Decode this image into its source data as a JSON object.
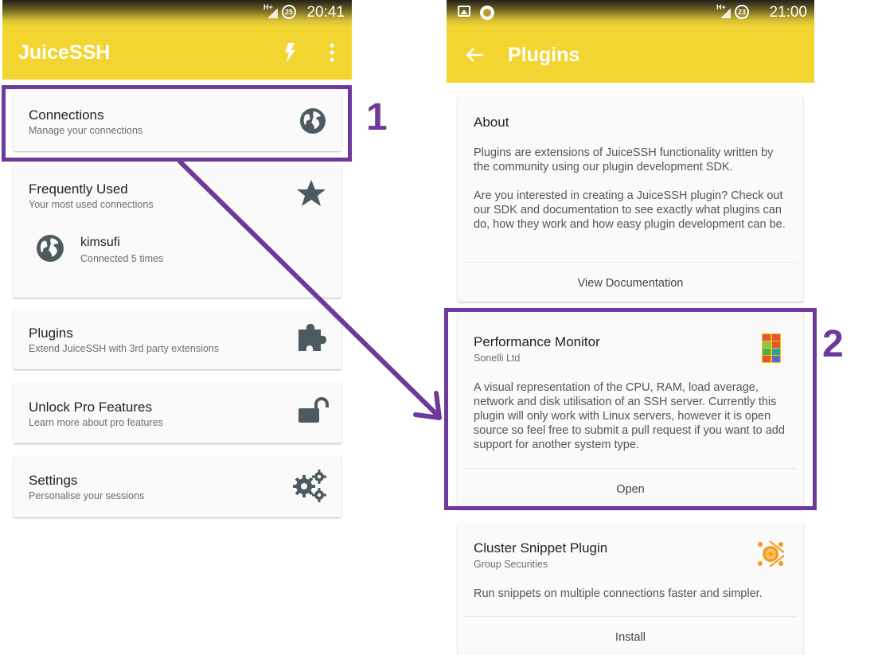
{
  "left": {
    "status": {
      "network": "H+",
      "battery": "25",
      "time": "20:41"
    },
    "appbar": {
      "title": "JuiceSSH"
    },
    "cards": {
      "connections": {
        "title": "Connections",
        "subtitle": "Manage your connections"
      },
      "frequent": {
        "title": "Frequently Used",
        "subtitle": "Your most used connections",
        "item": {
          "name": "kimsufi",
          "detail": "Connected 5 times"
        }
      },
      "plugins": {
        "title": "Plugins",
        "subtitle": "Extend JuiceSSH with 3rd party extensions"
      },
      "unlock": {
        "title": "Unlock Pro Features",
        "subtitle": "Learn more about pro features"
      },
      "settings": {
        "title": "Settings",
        "subtitle": "Personalise your sessions"
      }
    }
  },
  "right": {
    "status": {
      "network": "H+",
      "battery": "23",
      "time": "21:00"
    },
    "appbar": {
      "title": "Plugins"
    },
    "about": {
      "title": "About",
      "para1": "Plugins are extensions of JuiceSSH functionality written by the community using our plugin development SDK.",
      "para2": "Are you interested in creating a JuiceSSH plugin? Check out our SDK and documentation to see exactly what plugins can do, how they work and how easy plugin development can be.",
      "action": "View Documentation"
    },
    "perf": {
      "title": "Performance Monitor",
      "author": "Sonelli Ltd",
      "description": "A visual representation of the CPU, RAM, load average, network and disk utilisation of an SSH server. Currently this plugin will only work with Linux servers, however it is open source so feel free to submit a pull request if you want to add support for another system type.",
      "action": "Open"
    },
    "cluster": {
      "title": "Cluster Snippet Plugin",
      "author": "Group Securities",
      "description": "Run snippets on multiple connections faster and simpler.",
      "action": "Install"
    }
  },
  "annotations": {
    "step1": "1",
    "step2": "2",
    "color": "#6e3a9a"
  },
  "colors": {
    "appbar": "#f2d530",
    "icon": "#4d5a5f"
  }
}
